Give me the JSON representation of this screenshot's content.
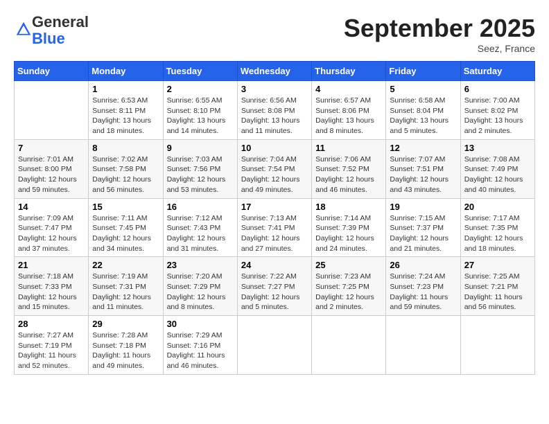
{
  "logo": {
    "general": "General",
    "blue": "Blue"
  },
  "header": {
    "month": "September 2025",
    "location": "Seez, France"
  },
  "days": [
    "Sunday",
    "Monday",
    "Tuesday",
    "Wednesday",
    "Thursday",
    "Friday",
    "Saturday"
  ],
  "weeks": [
    [
      {
        "day": "",
        "sunrise": "",
        "sunset": "",
        "daylight": ""
      },
      {
        "day": "1",
        "sunrise": "Sunrise: 6:53 AM",
        "sunset": "Sunset: 8:11 PM",
        "daylight": "Daylight: 13 hours and 18 minutes."
      },
      {
        "day": "2",
        "sunrise": "Sunrise: 6:55 AM",
        "sunset": "Sunset: 8:10 PM",
        "daylight": "Daylight: 13 hours and 14 minutes."
      },
      {
        "day": "3",
        "sunrise": "Sunrise: 6:56 AM",
        "sunset": "Sunset: 8:08 PM",
        "daylight": "Daylight: 13 hours and 11 minutes."
      },
      {
        "day": "4",
        "sunrise": "Sunrise: 6:57 AM",
        "sunset": "Sunset: 8:06 PM",
        "daylight": "Daylight: 13 hours and 8 minutes."
      },
      {
        "day": "5",
        "sunrise": "Sunrise: 6:58 AM",
        "sunset": "Sunset: 8:04 PM",
        "daylight": "Daylight: 13 hours and 5 minutes."
      },
      {
        "day": "6",
        "sunrise": "Sunrise: 7:00 AM",
        "sunset": "Sunset: 8:02 PM",
        "daylight": "Daylight: 13 hours and 2 minutes."
      }
    ],
    [
      {
        "day": "7",
        "sunrise": "Sunrise: 7:01 AM",
        "sunset": "Sunset: 8:00 PM",
        "daylight": "Daylight: 12 hours and 59 minutes."
      },
      {
        "day": "8",
        "sunrise": "Sunrise: 7:02 AM",
        "sunset": "Sunset: 7:58 PM",
        "daylight": "Daylight: 12 hours and 56 minutes."
      },
      {
        "day": "9",
        "sunrise": "Sunrise: 7:03 AM",
        "sunset": "Sunset: 7:56 PM",
        "daylight": "Daylight: 12 hours and 53 minutes."
      },
      {
        "day": "10",
        "sunrise": "Sunrise: 7:04 AM",
        "sunset": "Sunset: 7:54 PM",
        "daylight": "Daylight: 12 hours and 49 minutes."
      },
      {
        "day": "11",
        "sunrise": "Sunrise: 7:06 AM",
        "sunset": "Sunset: 7:52 PM",
        "daylight": "Daylight: 12 hours and 46 minutes."
      },
      {
        "day": "12",
        "sunrise": "Sunrise: 7:07 AM",
        "sunset": "Sunset: 7:51 PM",
        "daylight": "Daylight: 12 hours and 43 minutes."
      },
      {
        "day": "13",
        "sunrise": "Sunrise: 7:08 AM",
        "sunset": "Sunset: 7:49 PM",
        "daylight": "Daylight: 12 hours and 40 minutes."
      }
    ],
    [
      {
        "day": "14",
        "sunrise": "Sunrise: 7:09 AM",
        "sunset": "Sunset: 7:47 PM",
        "daylight": "Daylight: 12 hours and 37 minutes."
      },
      {
        "day": "15",
        "sunrise": "Sunrise: 7:11 AM",
        "sunset": "Sunset: 7:45 PM",
        "daylight": "Daylight: 12 hours and 34 minutes."
      },
      {
        "day": "16",
        "sunrise": "Sunrise: 7:12 AM",
        "sunset": "Sunset: 7:43 PM",
        "daylight": "Daylight: 12 hours and 31 minutes."
      },
      {
        "day": "17",
        "sunrise": "Sunrise: 7:13 AM",
        "sunset": "Sunset: 7:41 PM",
        "daylight": "Daylight: 12 hours and 27 minutes."
      },
      {
        "day": "18",
        "sunrise": "Sunrise: 7:14 AM",
        "sunset": "Sunset: 7:39 PM",
        "daylight": "Daylight: 12 hours and 24 minutes."
      },
      {
        "day": "19",
        "sunrise": "Sunrise: 7:15 AM",
        "sunset": "Sunset: 7:37 PM",
        "daylight": "Daylight: 12 hours and 21 minutes."
      },
      {
        "day": "20",
        "sunrise": "Sunrise: 7:17 AM",
        "sunset": "Sunset: 7:35 PM",
        "daylight": "Daylight: 12 hours and 18 minutes."
      }
    ],
    [
      {
        "day": "21",
        "sunrise": "Sunrise: 7:18 AM",
        "sunset": "Sunset: 7:33 PM",
        "daylight": "Daylight: 12 hours and 15 minutes."
      },
      {
        "day": "22",
        "sunrise": "Sunrise: 7:19 AM",
        "sunset": "Sunset: 7:31 PM",
        "daylight": "Daylight: 12 hours and 11 minutes."
      },
      {
        "day": "23",
        "sunrise": "Sunrise: 7:20 AM",
        "sunset": "Sunset: 7:29 PM",
        "daylight": "Daylight: 12 hours and 8 minutes."
      },
      {
        "day": "24",
        "sunrise": "Sunrise: 7:22 AM",
        "sunset": "Sunset: 7:27 PM",
        "daylight": "Daylight: 12 hours and 5 minutes."
      },
      {
        "day": "25",
        "sunrise": "Sunrise: 7:23 AM",
        "sunset": "Sunset: 7:25 PM",
        "daylight": "Daylight: 12 hours and 2 minutes."
      },
      {
        "day": "26",
        "sunrise": "Sunrise: 7:24 AM",
        "sunset": "Sunset: 7:23 PM",
        "daylight": "Daylight: 11 hours and 59 minutes."
      },
      {
        "day": "27",
        "sunrise": "Sunrise: 7:25 AM",
        "sunset": "Sunset: 7:21 PM",
        "daylight": "Daylight: 11 hours and 56 minutes."
      }
    ],
    [
      {
        "day": "28",
        "sunrise": "Sunrise: 7:27 AM",
        "sunset": "Sunset: 7:19 PM",
        "daylight": "Daylight: 11 hours and 52 minutes."
      },
      {
        "day": "29",
        "sunrise": "Sunrise: 7:28 AM",
        "sunset": "Sunset: 7:18 PM",
        "daylight": "Daylight: 11 hours and 49 minutes."
      },
      {
        "day": "30",
        "sunrise": "Sunrise: 7:29 AM",
        "sunset": "Sunset: 7:16 PM",
        "daylight": "Daylight: 11 hours and 46 minutes."
      },
      {
        "day": "",
        "sunrise": "",
        "sunset": "",
        "daylight": ""
      },
      {
        "day": "",
        "sunrise": "",
        "sunset": "",
        "daylight": ""
      },
      {
        "day": "",
        "sunrise": "",
        "sunset": "",
        "daylight": ""
      },
      {
        "day": "",
        "sunrise": "",
        "sunset": "",
        "daylight": ""
      }
    ]
  ]
}
